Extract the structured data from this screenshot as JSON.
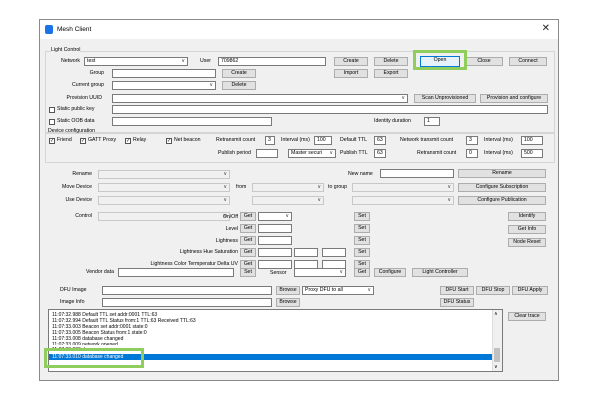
{
  "window": {
    "title": "Mesh Client"
  },
  "light_control": {
    "label": "Light Control",
    "network_label": "Network",
    "network_value": "test",
    "user_label": "User",
    "user_value": "709862",
    "create": "Create",
    "delete": "Delete",
    "open": "Open",
    "close": "Close",
    "connect": "Connect",
    "group_label": "Group",
    "group_create": "Create",
    "import": "Import",
    "export": "Export",
    "current_group_label": "Current group",
    "current_group_delete": "Delete",
    "provision_uuid_label": "Provision UUID",
    "scan_unprovisioned": "Scan Unprovisioned",
    "provision_configure": "Provision and configure",
    "static_public_key": "Static public key",
    "static_oob_data": "Static OOB data",
    "identity_duration_label": "Identity duration",
    "identity_duration_value": "1"
  },
  "device_config": {
    "label": "Device configuration",
    "friend": "Friend",
    "gatt_proxy": "GATT Proxy",
    "relay": "Relay",
    "net_beacon": "Net beacon",
    "retransmit_count_label": "Retransmit count",
    "retransmit_count_value": "3",
    "interval_label": "Interval (ms)",
    "interval_value": "100",
    "default_ttl_label": "Default TTL",
    "default_ttl_value": "63",
    "net_transmit_count_label": "Network transmit count",
    "net_transmit_count_value": "3",
    "net_interval_label": "Interval (ms)",
    "net_interval_value": "100",
    "publish_period_label": "Publish period",
    "master_security": "Master securi",
    "publish_ttl_label": "Publish TTL",
    "publish_ttl_value": "63",
    "retransmit_count2_label": "Retransmit count",
    "retransmit_count2_value": "0",
    "interval2_label": "Interval (ms)",
    "interval2_value": "500"
  },
  "device_ops": {
    "rename_label": "Rename",
    "new_name_label": "New name",
    "rename_button": "Rename",
    "move_device_label": "Move Device",
    "from_label": "from",
    "to_group_label": "to group",
    "configure_subscription": "Configure Subscription",
    "use_device_label": "Use Device",
    "configure_publication": "Configure Publication"
  },
  "control": {
    "control_label": "Control",
    "onoff_label": "On/Off",
    "level_label": "Level",
    "lightness_label": "Lightness",
    "hue_sat_label": "Lightness Hue Saturation",
    "color_temp_label": "Lightness Color Termperatur Delta UV",
    "get": "Get",
    "set": "Set",
    "identify": "Identify",
    "get_info": "Get Info",
    "node_reset": "Node Reset",
    "vendor_data_label": "Vendor data",
    "sensor_label": "Sensor",
    "configure": "Configure",
    "light_controller": "Light Controller"
  },
  "dfu": {
    "dfu_image_label": "DFU Image",
    "image_info_label": "Image Info",
    "browse": "Browse",
    "proxy_dfu": "Proxy DFU to all",
    "dfu_start": "DFU Start",
    "dfu_stop": "DFU Stop",
    "dfu_apply": "DFU Apply",
    "dfu_status": "DFU Status"
  },
  "log": {
    "lines": [
      "11:07:32.988 Default TTL set addr:0001 TTL:63",
      "11:07:32.994 Default TTL Status from:1 TTL:63 Received TTL:63",
      "11:07:33.003 Beacon set addr:0001 state:0",
      "11:07:33.005 Beacon Status from:1 state:0",
      "11:07:33.008 database changed",
      "11:07:33.009 network opened",
      "11:07:33.009 done",
      "11:07:33.010 database changed"
    ],
    "clear_trace": "Clear trace"
  },
  "colors": {
    "highlight": "#8fce5c",
    "selection": "#0078d7"
  }
}
